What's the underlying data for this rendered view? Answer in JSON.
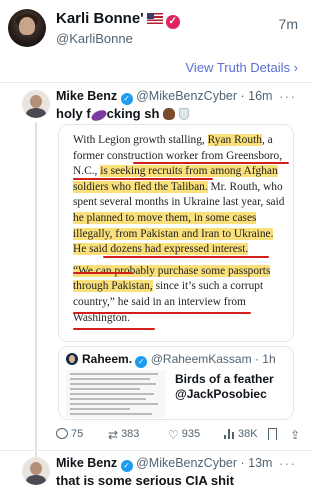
{
  "header": {
    "display_name": "Karli Bonne'",
    "handle": "@KarliBonne",
    "time": "7m"
  },
  "view_details": "View Truth Details",
  "quoted_post": {
    "name": "Mike Benz",
    "handle": "@MikeBenzCyber",
    "time": "16m",
    "text_start": "holy f",
    "text_mid": "cking sh",
    "article_paragraphs": [
      "With Legion growth stalling, Ryan Routh, a former construction worker from Greensboro, N.C., is seeking recruits from among Afghan soldiers who fled the Taliban. Mr. Routh, who spent several months in Ukraine last year, said he planned to move them, in some cases illegally, from Pakistan and Iran to Ukraine. He said dozens had expressed interest.",
      "“We can probably purchase some passports through Pakistan, since it’s such a corrupt country,” he said in an interview from Washington."
    ],
    "embed": {
      "name": "Raheem.",
      "handle": "@RaheemKassam",
      "time": "1h",
      "caption_line1": "Birds of a feather",
      "caption_line2": "@JackPosobiec"
    },
    "actions": {
      "replies": "75",
      "reposts": "383",
      "likes": "935",
      "views": "38K"
    }
  },
  "reply_post": {
    "name": "Mike Benz",
    "handle": "@MikeBenzCyber",
    "time": "13m",
    "text": "that is some serious CIA shit"
  },
  "colors": {
    "highlight": "#fae07a",
    "underline": "#d1201c",
    "link": "#5b6fd6",
    "verified_blue": "#1d9bf0",
    "truth_badge": "#e0245e"
  }
}
